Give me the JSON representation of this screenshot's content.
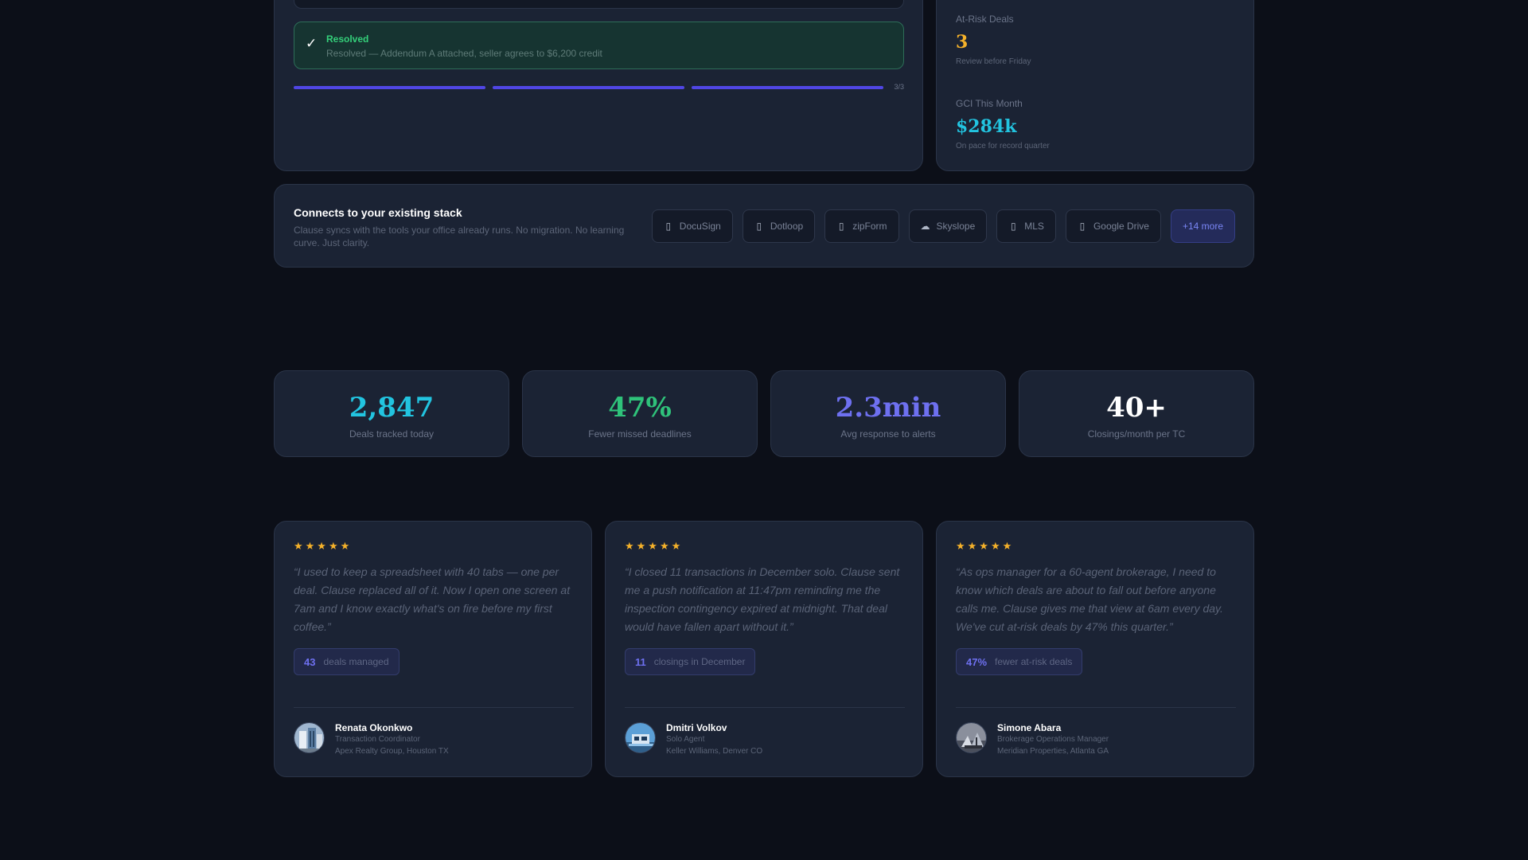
{
  "resolved": {
    "check_icon": "✓",
    "title": "Resolved",
    "description": "Resolved — Addendum A attached, seller agrees to $6,200 credit"
  },
  "progress": {
    "count_text": "3/3",
    "completed": 3,
    "total": 3
  },
  "kpis": [
    {
      "label": "At-Risk Deals",
      "value": "3",
      "note": "Review before Friday",
      "color": "#f6b22a"
    },
    {
      "label": "GCI This Month",
      "value": "$284k",
      "note": "On pace for record quarter",
      "color": "#22c4e0"
    }
  ],
  "integrations": {
    "title": "Connects to your existing stack",
    "description": "Clause syncs with the tools your office already runs. No migration. No learning curve. Just clarity.",
    "items": [
      {
        "label": "DocuSign",
        "icon": "document-icon",
        "glyph": "▯"
      },
      {
        "label": "Dotloop",
        "icon": "document-icon",
        "glyph": "▯"
      },
      {
        "label": "zipForm",
        "icon": "document-icon",
        "glyph": "▯"
      },
      {
        "label": "Skyslope",
        "icon": "cloud-icon",
        "glyph": "☁"
      },
      {
        "label": "MLS",
        "icon": "document-icon",
        "glyph": "▯"
      },
      {
        "label": "Google Drive",
        "icon": "document-icon",
        "glyph": "▯"
      }
    ],
    "more_label": "+14 more"
  },
  "stats": [
    {
      "value": "2,847",
      "label": "Deals tracked today",
      "color": "#22c4e0"
    },
    {
      "value": "47%",
      "label": "Fewer missed deadlines",
      "color": "#2fc27a"
    },
    {
      "value": "2.3min",
      "label": "Avg response to alerts",
      "color": "#6e70f0"
    },
    {
      "value": "40+",
      "label": "Closings/month per TC",
      "color": "#ffffff"
    }
  ],
  "testimonials": [
    {
      "stars": "★★★★★",
      "quote": "“I used to keep a spreadsheet with 40 tabs — one per deal. Clause replaced all of it. Now I open one screen at 7am and I know exactly what's on fire before my first coffee.”",
      "metric_value": "43",
      "metric_label": "deals managed",
      "name": "Renata Okonkwo",
      "role": "Transaction Coordinator",
      "org": "Apex Realty Group, Houston TX"
    },
    {
      "stars": "★★★★★",
      "quote": "“I closed 11 transactions in December solo. Clause sent me a push notification at 11:47pm reminding me the inspection contingency expired at midnight. That deal would have fallen apart without it.”",
      "metric_value": "11",
      "metric_label": "closings in December",
      "name": "Dmitri Volkov",
      "role": "Solo Agent",
      "org": "Keller Williams, Denver CO"
    },
    {
      "stars": "★★★★★",
      "quote": "“As ops manager for a 60-agent brokerage, I need to know which deals are about to fall out before anyone calls me. Clause gives me that view at 6am every day. We've cut at-risk deals by 47% this quarter.”",
      "metric_value": "47%",
      "metric_label": "fewer at-risk deals",
      "name": "Simone Abara",
      "role": "Brokerage Operations Manager",
      "org": "Meridian Properties, Atlanta GA"
    }
  ]
}
